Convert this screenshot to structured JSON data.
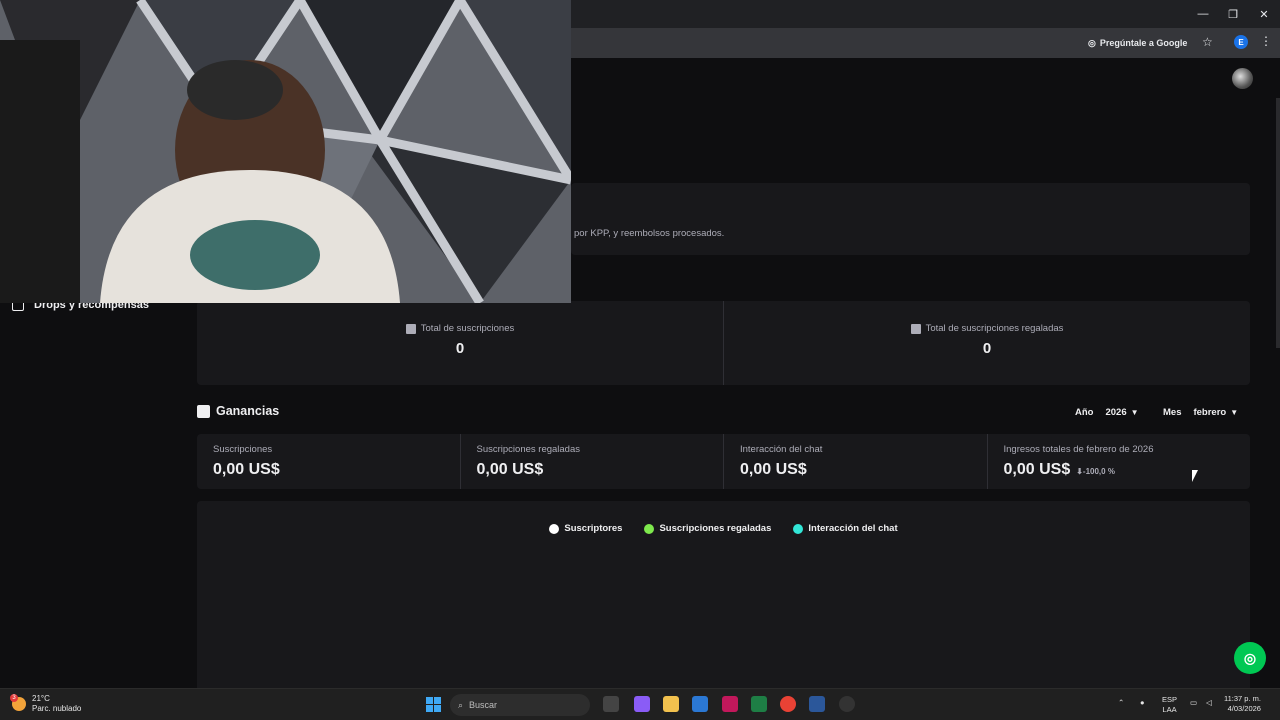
{
  "browser": {
    "ask_google": "Pregúntale a Google",
    "profile_initial": "E"
  },
  "info": {
    "text": "por KPP, y reembolsos procesados."
  },
  "sidebar": {
    "drops_label": "Drops y recompensas"
  },
  "totals": [
    {
      "label": "Total de suscripciones",
      "value": "0"
    },
    {
      "label": "Total de suscripciones regaladas",
      "value": "0"
    }
  ],
  "ganancias": {
    "title": "Ganancias",
    "year_label": "Año",
    "year_value": "2026",
    "month_label": "Mes",
    "month_value": "febrero"
  },
  "earnings": [
    {
      "label": "Suscripciones",
      "value": "0,00 US$"
    },
    {
      "label": "Suscripciones regaladas",
      "value": "0,00 US$"
    },
    {
      "label": "Interacción del chat",
      "value": "0,00 US$"
    },
    {
      "label": "Ingresos totales de febrero de 2026",
      "value": "0,00 US$",
      "delta": "-100,0 %"
    }
  ],
  "legend": [
    {
      "label": "Suscriptores",
      "color": "#ffffff"
    },
    {
      "label": "Suscripciones regaladas",
      "color": "#7ee84d"
    },
    {
      "label": "Interacción del chat",
      "color": "#32e6d7"
    }
  ],
  "taskbar": {
    "weather_temp": "21°C",
    "weather_desc": "Parc. nublado",
    "weather_badge": "3",
    "search_placeholder": "Buscar",
    "lang_top": "ESP",
    "lang_bottom": "LAA",
    "time": "11:37 p. m.",
    "date": "4/03/2026"
  }
}
